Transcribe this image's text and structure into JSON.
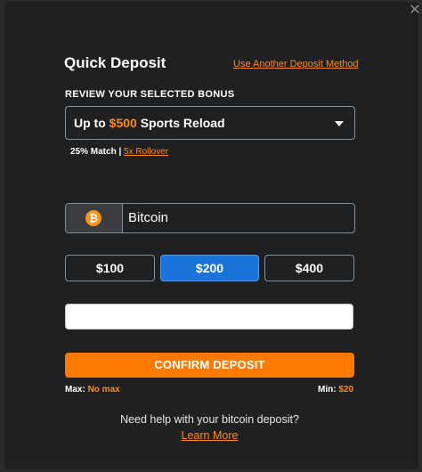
{
  "modal": {
    "title": "Quick Deposit",
    "alt_method_link": "Use Another Deposit Method",
    "close_icon": "close-icon"
  },
  "bonus": {
    "section_label": "REVIEW YOUR SELECTED BONUS",
    "selected_prefix": "Up to ",
    "selected_amount": "$500",
    "selected_suffix": " Sports Reload",
    "match": "25% Match",
    "separator": "|",
    "rollover": "5x Rollover"
  },
  "method": {
    "icon": "bitcoin-icon",
    "icon_glyph": "₿",
    "label": "Bitcoin"
  },
  "amounts": [
    {
      "label": "$100",
      "selected": false
    },
    {
      "label": "$200",
      "selected": true
    },
    {
      "label": "$400",
      "selected": false
    }
  ],
  "amount_input": {
    "value": "",
    "placeholder": ""
  },
  "confirm_label": "CONFIRM DEPOSIT",
  "limits": {
    "max_label": "Max:",
    "max_value": "No max",
    "min_label": "Min:",
    "min_value": "$20"
  },
  "help": {
    "text": "Need help with your bitcoin deposit?",
    "link": "Learn More"
  },
  "colors": {
    "accent": "#ff7a00",
    "selected": "#1a73d9",
    "background": "#1f2022"
  }
}
